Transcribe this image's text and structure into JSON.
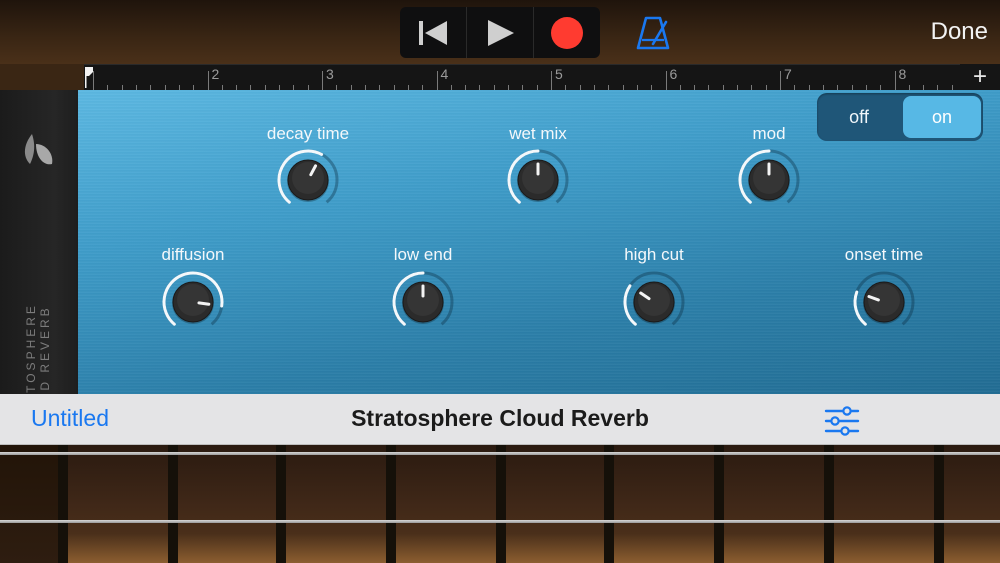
{
  "toolbar": {
    "done_label": "Done",
    "record_color": "#ff3b30",
    "accent_color": "#1a78f0"
  },
  "ruler": {
    "bars": [
      "2",
      "3",
      "4",
      "5",
      "6",
      "7",
      "8"
    ],
    "add_label": "+"
  },
  "plugin": {
    "vertical_brand": [
      "STRATOSPHERE",
      "CLOUD REVERB"
    ],
    "toggle": {
      "off_label": "off",
      "on_label": "on",
      "state": "on"
    },
    "knobs": {
      "decay_time": {
        "label": "decay time",
        "level": 0.6
      },
      "wet_mix": {
        "label": "wet mix",
        "level": 0.5
      },
      "mod": {
        "label": "mod",
        "level": 0.5
      },
      "diffusion": {
        "label": "diffusion",
        "level": 0.85
      },
      "low_end": {
        "label": "low end",
        "level": 0.5
      },
      "high_cut": {
        "label": "high cut",
        "level": 0.3
      },
      "onset_time": {
        "label": "onset time",
        "level": 0.25
      }
    }
  },
  "titlebar": {
    "song_name": "Untitled",
    "plugin_name": "Stratosphere Cloud Reverb"
  }
}
